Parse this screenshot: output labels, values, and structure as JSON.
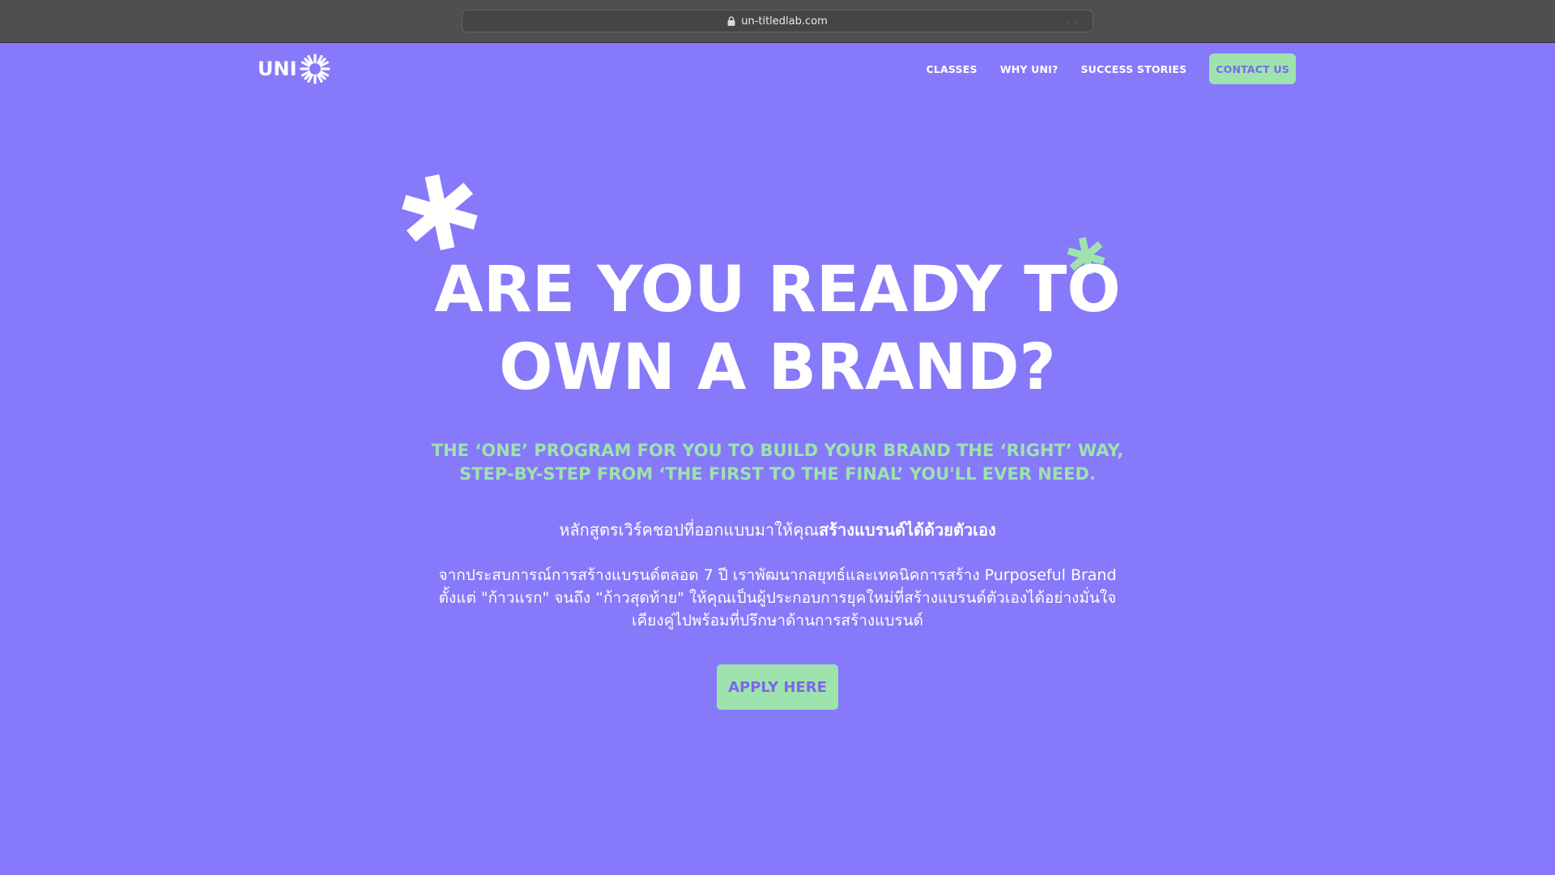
{
  "browser": {
    "url": "un-titledlab.com"
  },
  "logo": {
    "text": "UNI"
  },
  "nav": {
    "links": [
      "CLASSES",
      "WHY UNI?",
      "SUCCESS STORIES"
    ],
    "cta": "CONTACT US"
  },
  "hero": {
    "title_line1": "ARE YOU READY TO",
    "title_line2": "OWN A BRAND?",
    "tagline_line1": "THE ‘ONE’ PROGRAM FOR YOU TO BUILD YOUR BRAND THE ‘RIGHT’ WAY,",
    "tagline_line2": "STEP-BY-STEP FROM ‘THE FIRST TO THE FINAL’ YOU'LL EVER NEED.",
    "thai_intro": "หลักสูตรเวิร์คชอปที่ออกแบบมาให้คุณ",
    "thai_intro_bold": "สร้างแบรนด์ได้ด้วยตัวเอง",
    "thai_para_line1": "จากประสบการณ์การสร้างแบรนด์ตลอด 7 ปี  เราพัฒนากลยุทธ์และเทคนิคการสร้าง Purposeful Brand",
    "thai_para_line2": "ตั้งแต่ \"ก้าวแรก\" จนถึง “ก้าวสุดท้าย\" ให้คุณเป็นผู้ประกอบการยุคใหม่ที่สร้างแบรนด์ตัวเองได้อย่างมั่นใจ",
    "thai_para_line3": "เคียงคู่ไปพร้อมที่ปรึกษาด้านการสร้างแบรนด์",
    "apply_label": "APPLY HERE"
  },
  "colors": {
    "background": "#8679fa",
    "accent_green": "#9ee3ad",
    "accent_purple": "#7a68ea",
    "text": "#ffffff"
  }
}
